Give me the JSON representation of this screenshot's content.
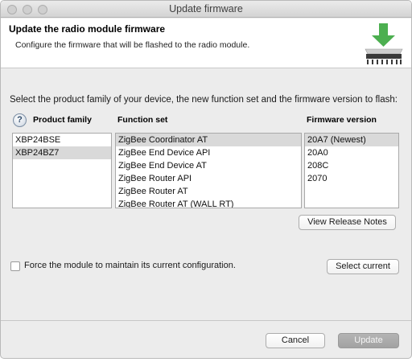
{
  "window": {
    "title": "Update firmware"
  },
  "header": {
    "title": "Update the radio module firmware",
    "subtitle": "Configure the firmware that will be flashed to the radio module.",
    "icon": "firmware-flash-chip-icon"
  },
  "instruction": "Select the product family of your device, the new function set and the firmware version to flash:",
  "columns": {
    "help_glyph": "?",
    "product_family": "Product family",
    "function_set": "Function set",
    "firmware_version": "Firmware version"
  },
  "product_family": {
    "items": [
      "XBP24BSE",
      "XBP24BZ7"
    ],
    "selected_index": 1
  },
  "function_set": {
    "items": [
      "ZigBee Coordinator AT",
      "ZigBee End Device API",
      "ZigBee End Device AT",
      "ZigBee Router API",
      "ZigBee Router AT",
      "ZigBee Router AT (WALL RT)"
    ],
    "selected_index": 0
  },
  "firmware_version": {
    "items": [
      "20A7 (Newest)",
      "20A0",
      "208C",
      "2070"
    ],
    "selected_index": 0
  },
  "buttons": {
    "view_release_notes": "View Release Notes",
    "select_current": "Select current",
    "cancel": "Cancel",
    "update": "Update"
  },
  "options": {
    "force_config_label": "Force the module to maintain its current configuration.",
    "force_config_checked": false
  },
  "colors": {
    "selection": "#d9d9d9",
    "arrow_green": "#4caf50",
    "chip_dark": "#3a3a3a",
    "disabled_button": "#aaaaaa"
  }
}
